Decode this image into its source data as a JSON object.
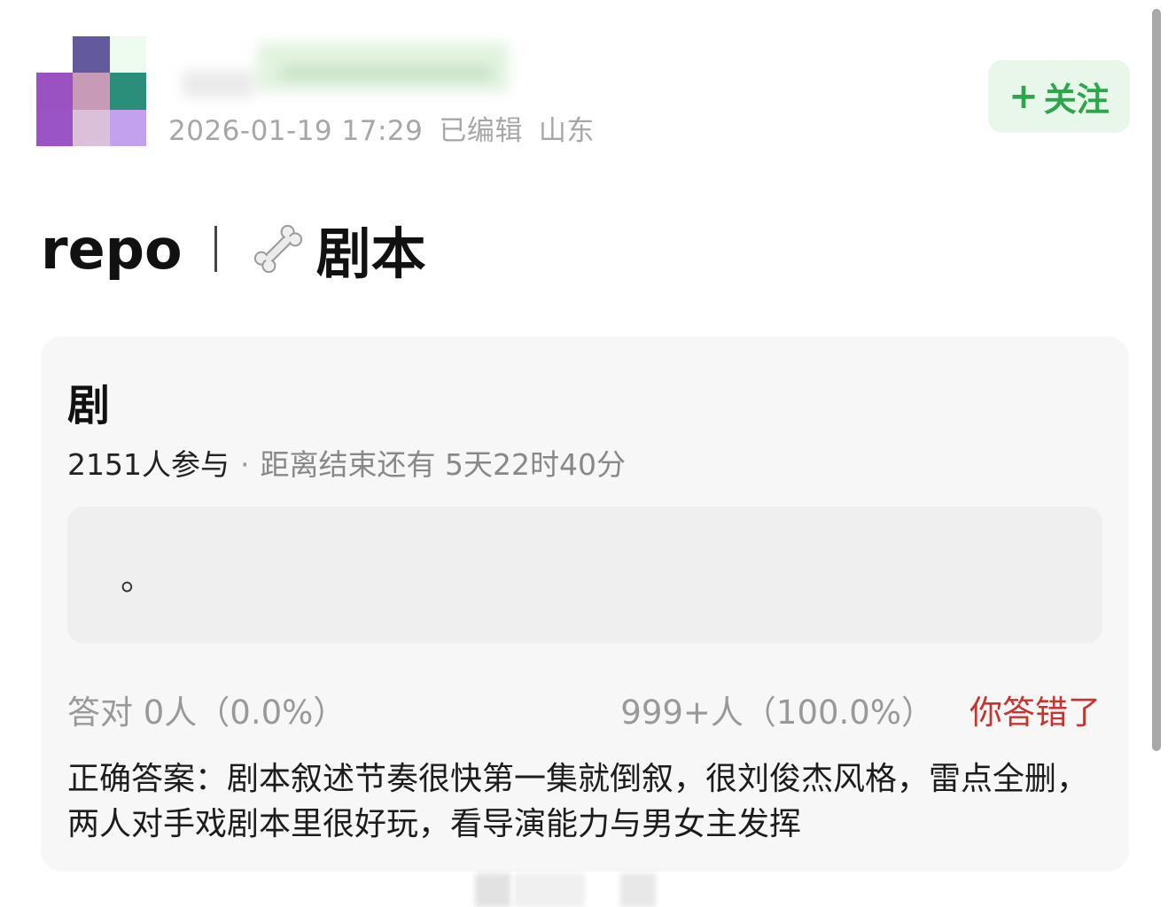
{
  "post": {
    "timestamp": "2026-01-19 17:29",
    "edited": "已编辑",
    "location": "山东",
    "follow_label": "关注",
    "follow_icon": "plus-icon",
    "title_main": "repo",
    "title_icon": "bone-icon",
    "title_sub": "剧本"
  },
  "quiz": {
    "question": "剧",
    "participants": "2151人参与",
    "time_left": "距离结束还有 5天22时40分",
    "option_text": "。",
    "correct_result": "答对  0人（0.0%）",
    "wrong_result": "999+人（100.0%）",
    "user_result": "你答错了",
    "answer": "正确答案：剧本叙述节奏很快第一集就倒叙，很刘俊杰风格，雷点全删，两人对手戏剧本里很好玩，看导演能力与男女主发挥"
  },
  "colors": {
    "follow_text": "#2ba64a",
    "follow_bg": "#e9f6ea",
    "wrong_text": "#c7332d",
    "card_bg": "#f7f7f7"
  }
}
